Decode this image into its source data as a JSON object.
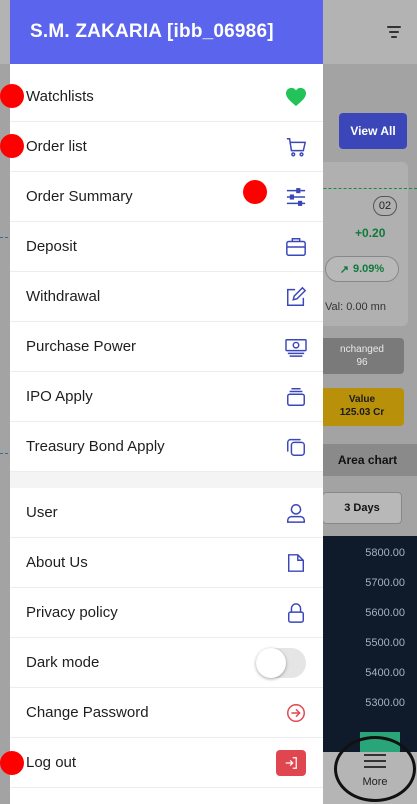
{
  "drawer": {
    "title": "S.M. ZAKARIA [ibb_06986]",
    "items": [
      {
        "label": "Watchlists",
        "icon": "heart-icon"
      },
      {
        "label": "Order list",
        "icon": "cart-icon"
      },
      {
        "label": "Order Summary",
        "icon": "sliders-icon"
      },
      {
        "label": "Deposit",
        "icon": "briefcase-icon"
      },
      {
        "label": "Withdrawal",
        "icon": "edit-icon"
      },
      {
        "label": "Purchase Power",
        "icon": "money-icon"
      },
      {
        "label": "IPO Apply",
        "icon": "stack-icon"
      },
      {
        "label": "Treasury Bond Apply",
        "icon": "copy-icon"
      },
      {
        "label": "User",
        "icon": "user-icon"
      },
      {
        "label": "About Us",
        "icon": "file-icon"
      },
      {
        "label": "Privacy policy",
        "icon": "lock-icon"
      },
      {
        "label": "Dark mode",
        "icon": "toggle"
      },
      {
        "label": "Change Password",
        "icon": "arrow-circle-icon"
      },
      {
        "label": "Log out",
        "icon": "logout-icon"
      }
    ],
    "dark_mode": false
  },
  "background": {
    "view_all": "View All",
    "badge": "02",
    "change": "+0.20",
    "pct": "9.09%",
    "val": "Val: 0.00 mn",
    "unchanged_label": "nchanged",
    "unchanged_value": "96",
    "value_label": "Value",
    "value_amount": "125.03 Cr",
    "area_chart": "Area chart",
    "days": "3 Days",
    "ticks": [
      "5800.00",
      "5700.00",
      "5600.00",
      "5500.00",
      "5400.00",
      "5300.00"
    ],
    "more": "More"
  },
  "colors": {
    "header": "#5b64ec",
    "heart": "#23c35a",
    "icon_blue": "#3b47b8",
    "logout": "#e0464f",
    "marker": "#ff0000"
  }
}
